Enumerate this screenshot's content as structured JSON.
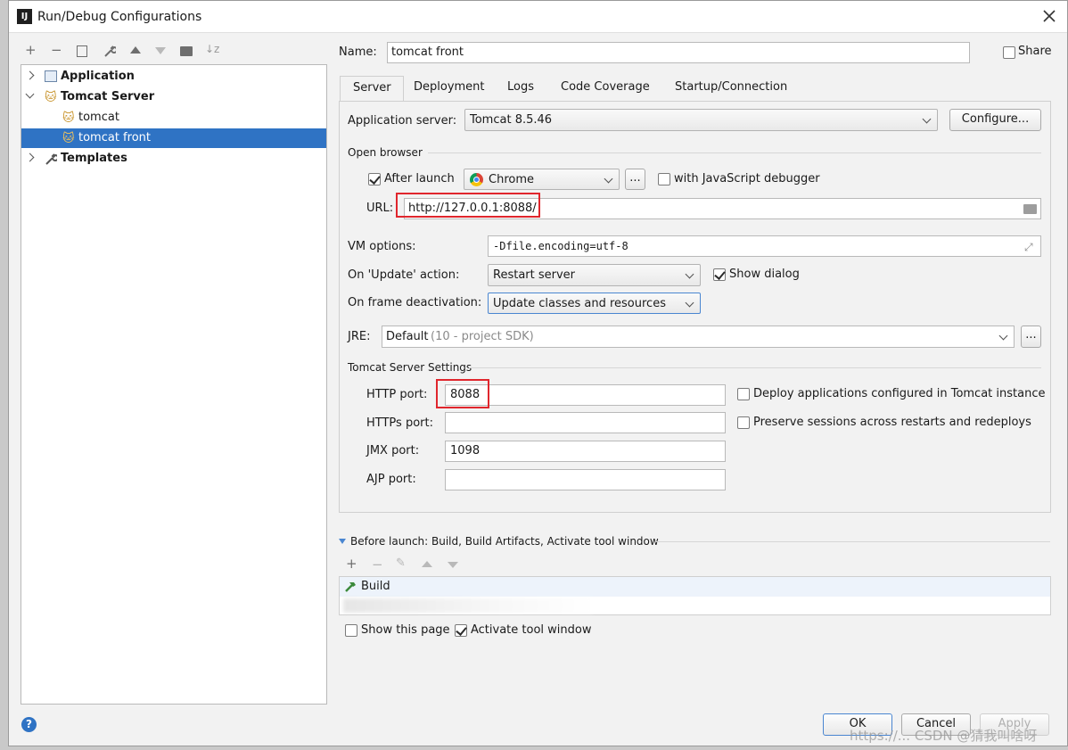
{
  "window": {
    "title": "Run/Debug Configurations"
  },
  "tree": {
    "items": [
      {
        "label": "Application"
      },
      {
        "label": "Tomcat Server"
      },
      {
        "label": "tomcat"
      },
      {
        "label": "tomcat front"
      },
      {
        "label": "Templates"
      }
    ]
  },
  "form": {
    "name_label": "Name:",
    "name_value": "tomcat front",
    "share_label": "Share",
    "tabs": [
      "Server",
      "Deployment",
      "Logs",
      "Code Coverage",
      "Startup/Connection"
    ],
    "app_server_label": "Application server:",
    "app_server_value": "Tomcat 8.5.46",
    "configure_label": "Configure...",
    "open_browser_title": "Open browser",
    "after_launch_label": "After launch",
    "browser_value": "Chrome",
    "browse_ellipsis": "...",
    "js_debugger_label": "with JavaScript debugger",
    "url_label": "URL:",
    "url_value": "http://127.0.0.1:8088/",
    "vm_options_label": "VM options:",
    "vm_options_value": "-Dfile.encoding=utf-8",
    "on_update_label": "On 'Update' action:",
    "on_update_value": "Restart server",
    "show_dialog_label": "Show dialog",
    "frame_deactivation_label": "On frame deactivation:",
    "frame_deactivation_value": "Update classes and resources",
    "jre_label": "JRE:",
    "jre_value": "Default",
    "jre_hint": "(10 - project SDK)",
    "jre_ellipsis": "...",
    "tomcat_settings_title": "Tomcat Server Settings",
    "http_port_label": "HTTP port:",
    "http_port_value": "8088",
    "https_port_label": "HTTPs port:",
    "https_port_value": "",
    "jmx_port_label": "JMX port:",
    "jmx_port_value": "1098",
    "ajp_port_label": "AJP port:",
    "ajp_port_value": "",
    "deploy_label": "Deploy applications configured in Tomcat instance",
    "preserve_label": "Preserve sessions across restarts and redeploys"
  },
  "before_launch": {
    "title": "Before launch: Build, Build Artifacts, Activate tool window",
    "items": [
      "Build"
    ],
    "show_page_label": "Show this page",
    "activate_tool_label": "Activate tool window"
  },
  "footer": {
    "ok_label": "OK",
    "cancel_label": "Cancel",
    "apply_label": "Apply",
    "watermark": "https://... CSDN @猜我叫啥呀"
  },
  "icons": {
    "app_icon": "intellij-icon",
    "close": "close-icon"
  },
  "colors": {
    "selection": "#2f73c4",
    "highlight_box": "#e0262d",
    "tab_border": "#cfcfcf"
  }
}
